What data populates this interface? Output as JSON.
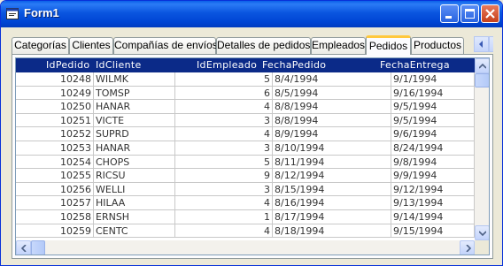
{
  "window": {
    "title": "Form1"
  },
  "tabs": [
    "Categorías",
    "Clientes",
    "Compañías de envíos",
    "Detalles de pedidos",
    "Empleados",
    "Pedidos",
    "Productos"
  ],
  "active_tab": "Pedidos",
  "grid": {
    "columns": [
      "IdPedido",
      "IdCliente",
      "IdEmpleado",
      "FechaPedido",
      "FechaEntrega"
    ],
    "rows": [
      [
        "10248",
        "WILMK",
        "5",
        "8/4/1994",
        "9/1/1994"
      ],
      [
        "10249",
        "TOMSP",
        "6",
        "8/5/1994",
        "9/16/1994"
      ],
      [
        "10250",
        "HANAR",
        "4",
        "8/8/1994",
        "9/5/1994"
      ],
      [
        "10251",
        "VICTE",
        "3",
        "8/8/1994",
        "9/5/1994"
      ],
      [
        "10252",
        "SUPRD",
        "4",
        "8/9/1994",
        "9/6/1994"
      ],
      [
        "10253",
        "HANAR",
        "3",
        "8/10/1994",
        "8/24/1994"
      ],
      [
        "10254",
        "CHOPS",
        "5",
        "8/11/1994",
        "9/8/1994"
      ],
      [
        "10255",
        "RICSU",
        "9",
        "8/12/1994",
        "9/9/1994"
      ],
      [
        "10256",
        "WELLI",
        "3",
        "8/15/1994",
        "9/12/1994"
      ],
      [
        "10257",
        "HILAA",
        "4",
        "8/16/1994",
        "9/13/1994"
      ],
      [
        "10258",
        "ERNSH",
        "1",
        "8/17/1994",
        "9/14/1994"
      ],
      [
        "10259",
        "CENTC",
        "4",
        "8/18/1994",
        "9/15/1994"
      ]
    ]
  },
  "colors": {
    "header_bg": "#0b2a88",
    "active_tab_accent": "#ffc83c",
    "titlebar": "#0a55df"
  },
  "icons": [
    "window-icon",
    "minimize-icon",
    "maximize-icon",
    "close-icon",
    "tab-scroll-left-icon",
    "tab-scroll-right-icon",
    "scroll-up-icon",
    "scroll-down-icon",
    "scroll-left-icon",
    "scroll-right-icon"
  ]
}
